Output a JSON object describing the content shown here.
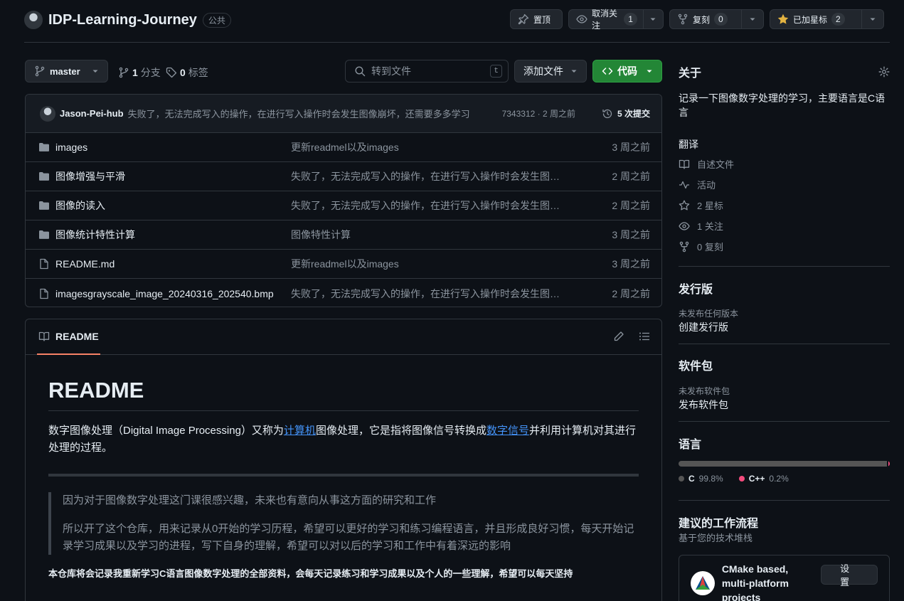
{
  "repo": {
    "name": "IDP-Learning-Journey",
    "visibility": "公共"
  },
  "header_buttons": {
    "pin": {
      "label": "置顶"
    },
    "watch": {
      "label": "取消关注",
      "count": "1"
    },
    "fork": {
      "label": "复刻",
      "count": "0"
    },
    "star": {
      "label": "已加星标",
      "count": "2"
    }
  },
  "toolbar": {
    "branch": "master",
    "branches_count": "1",
    "branches_label": "分支",
    "tags_count": "0",
    "tags_label": "标签",
    "search_placeholder": "转到文件",
    "search_shortcut": "t",
    "add_file": "添加文件",
    "code": "代码"
  },
  "latest_commit": {
    "author": "Jason-Pei-hub",
    "message": "失败了，无法完成写入的操作，在进行写入操作时会发生图像崩坏，还需要多多学习",
    "meta": "7343312 · 2 周之前",
    "commits_count": "5 次提交"
  },
  "files": [
    {
      "type": "folder",
      "name": "images",
      "message": "更新readmel以及images",
      "date": "3 周之前"
    },
    {
      "type": "folder",
      "name": "图像增强与平滑",
      "message": "失败了，无法完成写入的操作，在进行写入操作时会发生图像崩坏",
      "date": "2 周之前"
    },
    {
      "type": "folder",
      "name": "图像的读入",
      "message": "失败了，无法完成写入的操作，在进行写入操作时会发生图像崩坏",
      "date": "2 周之前"
    },
    {
      "type": "folder",
      "name": "图像统计特性计算",
      "message": "图像特性计算",
      "date": "3 周之前"
    },
    {
      "type": "file",
      "name": "README.md",
      "message": "更新readmel以及images",
      "date": "3 周之前"
    },
    {
      "type": "file",
      "name": "imagesgrayscale_image_20240316_202540.bmp",
      "message": "失败了，无法完成写入的操作，在进行写入操作时会发生图像崩坏",
      "date": "2 周之前"
    }
  ],
  "readme": {
    "tab": "README",
    "title": "README",
    "lead_part1": "数字图像处理（Digital Image Processing）又称为",
    "lead_link1": "计算机",
    "lead_part2": "图像处理，它是指将图像信号转换成",
    "lead_link2": "数字信号",
    "lead_part3": "并利用计算机对其进行处理的过程。",
    "quote1": "因为对于图像数字处理这门课很感兴趣，未来也有意向从事这方面的研究和工作",
    "quote2": "所以开了这个仓库，用来记录从0开始的学习历程，希望可以更好的学习和练习编程语言，并且形成良好习惯，每天开始记录学习成果以及学习的进程，写下自身的理解，希望可以对以后的学习和工作中有着深远的影响",
    "bold_line": "本仓库将会记录我重新学习C语言图像数字处理的全部资料，会每天记录练习和学习成果以及个人的一些理解，希望可以每天坚持"
  },
  "sidebar": {
    "about_title": "关于",
    "description": "记录一下图像数字处理的学习，主要语言是C语言",
    "translate": "翻译",
    "items": [
      {
        "icon": "book-icon",
        "label": "自述文件"
      },
      {
        "icon": "pulse-icon",
        "label": "活动"
      },
      {
        "icon": "star-icon",
        "label": "2 星标"
      },
      {
        "icon": "eye-icon",
        "label": "1 关注"
      },
      {
        "icon": "fork-icon",
        "label": "0 复刻"
      }
    ],
    "releases_title": "发行版",
    "releases_none": "未发布任何版本",
    "releases_link": "创建发行版",
    "packages_title": "软件包",
    "packages_none": "未发布软件包",
    "packages_link": "发布软件包",
    "languages_title": "语言",
    "languages": [
      {
        "name": "C",
        "percent": "99.8%",
        "value": 99.8,
        "color": "#555555"
      },
      {
        "name": "C++",
        "percent": "0.2%",
        "value": 0.2,
        "color": "#f34b7d"
      }
    ],
    "workflows_title": "建议的工作流程",
    "workflows_subtitle": "基于您的技术堆栈",
    "workflow_card": {
      "title": "CMake based, multi-platform projects",
      "button": "设置"
    }
  }
}
